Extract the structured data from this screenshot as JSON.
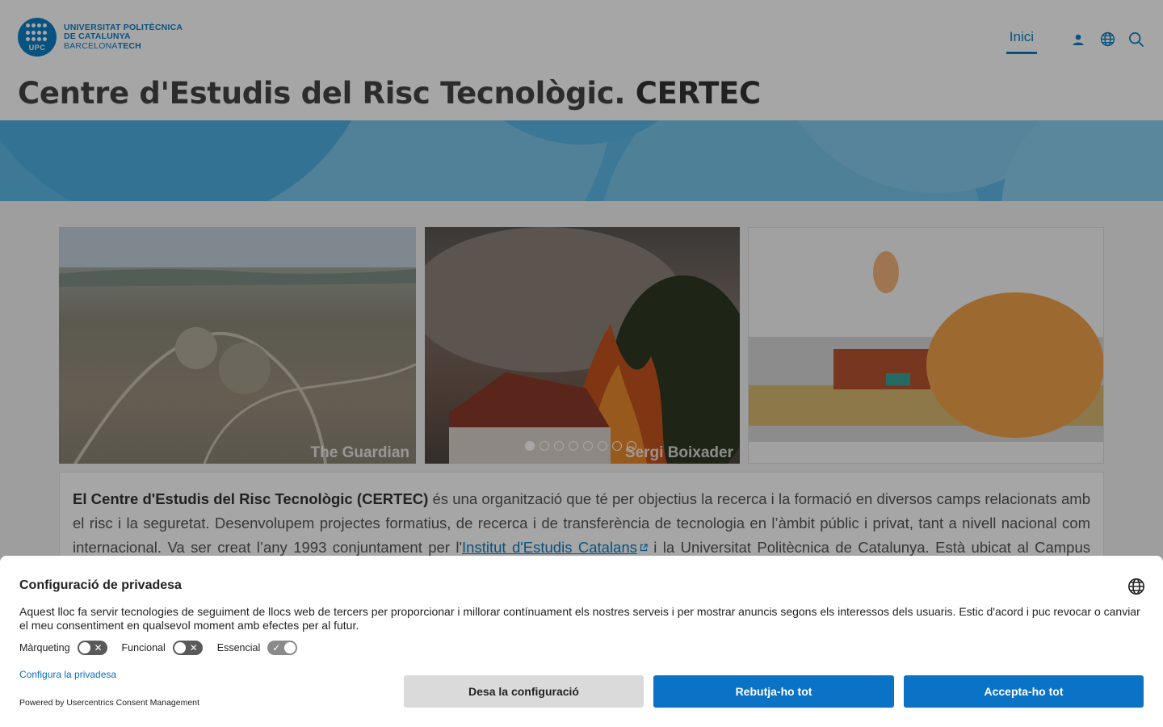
{
  "header": {
    "logo": {
      "badge": "UPC",
      "line1": "UNIVERSITAT POLITÈCNICA",
      "line2": "DE CATALUNYA",
      "line3_a": "BARCELONA",
      "line3_b": "TECH"
    },
    "nav": {
      "home_label": "Inici",
      "user_icon": "user-icon",
      "language_icon": "globe-icon",
      "search_icon": "search-icon"
    },
    "title_main": "Centre d'Estudis del Risc Tecnològic.",
    "title_bold": "CERTEC"
  },
  "carousel": {
    "slides": [
      {
        "credit": "The Guardian"
      },
      {
        "credit": "Sergi Boixader"
      },
      {
        "credit": ""
      }
    ],
    "dot_count": 8,
    "active_dot": 0
  },
  "intro": {
    "bold_name": "El Centre d'Estudis del Risc Tecnològic (CERTEC)",
    "text_1": " és una organització que té per objectius la recerca i la formació en diversos camps relacionats amb el risc i la seguretat. Desenvolupem projectes formatius, de recerca i de transferència de tecnologia en l’àmbit públic i privat, tant a nivell nacional com internacional. Va ser creat l’any 1993 conjuntament per l'",
    "link_text": "Institut d'Estudis Catalans",
    "text_2": " i la Universitat Politècnica de Catalunya. Està ubicat al Campus Diagonal Besòs de la UPC"
  },
  "consent": {
    "title": "Configuració de privadesa",
    "body": "Aquest lloc fa servir tecnologies de seguiment de llocs web de tercers per proporcionar i millorar contínuament els nostres serveis i per mostrar anuncis segons els interessos dels usuaris. Estic d'acord i puc revocar o canviar el meu consentiment en qualsevol moment amb efectes per al futur.",
    "toggles": [
      {
        "label": "Màrqueting",
        "on": false
      },
      {
        "label": "Funcional",
        "on": false
      },
      {
        "label": "Essencial",
        "on": true
      }
    ],
    "configure_link": "Configura la privadesa",
    "powered_by": "Powered by Usercentrics Consent Management",
    "buttons": {
      "save": "Desa la configuració",
      "reject": "Rebutja-ho tot",
      "accept": "Accepta-ho tot"
    }
  },
  "colors": {
    "brand_blue": "#0d7fc4",
    "button_blue": "#0a73c6",
    "banner_blue": "#5fb9e6"
  }
}
